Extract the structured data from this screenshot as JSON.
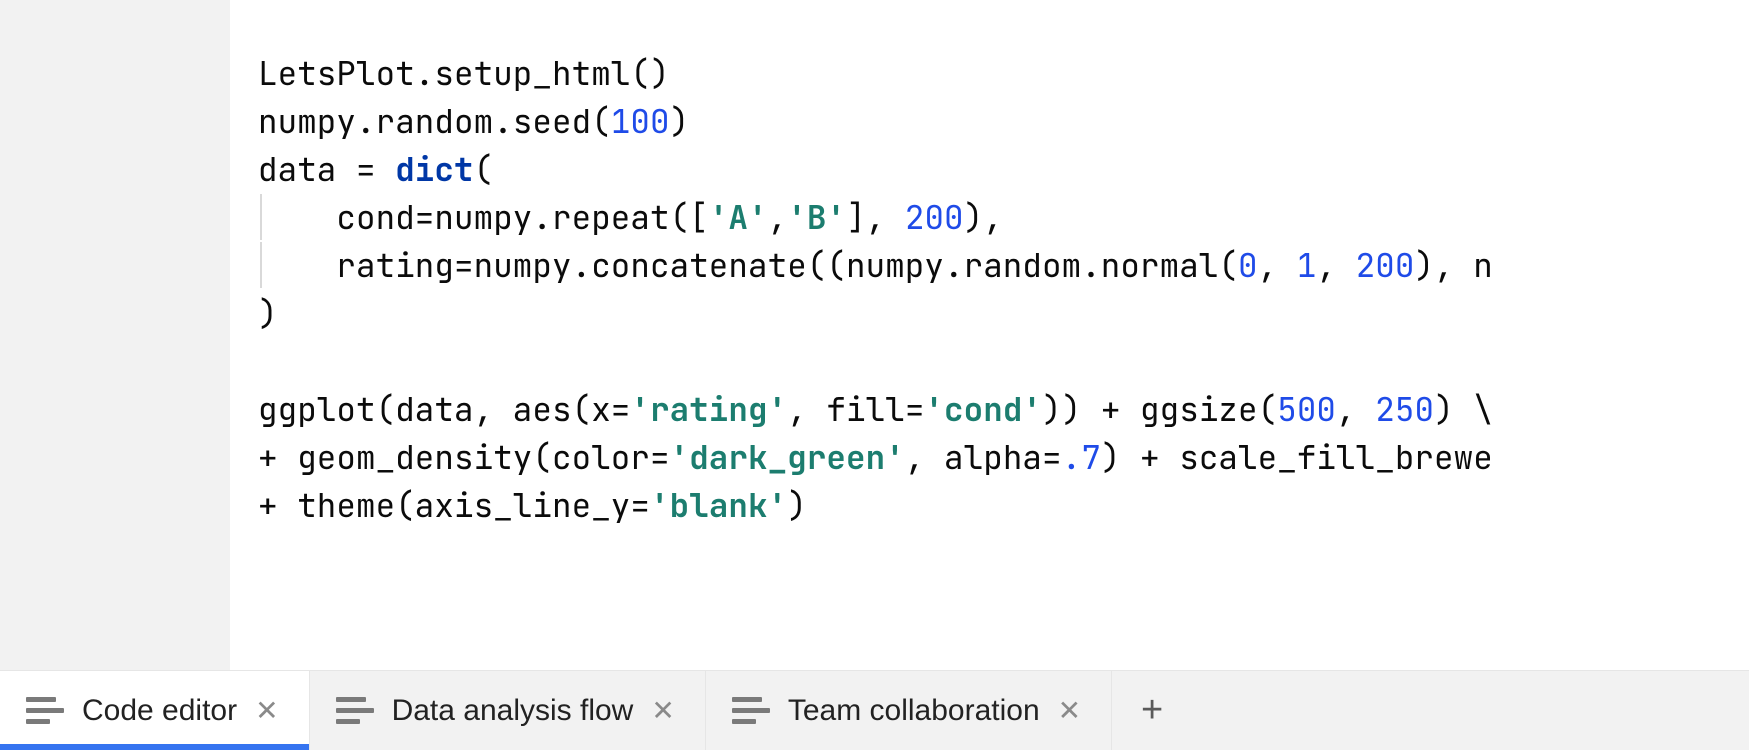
{
  "code": {
    "l1_a": "LetsPlot.setup_html()",
    "l2_a": "numpy.random.seed(",
    "l2_num": "100",
    "l2_b": ")",
    "l3_a": "data = ",
    "l3_kw": "dict",
    "l3_b": "(",
    "l4_a": "    cond=numpy.repeat([",
    "l4_s1": "'A'",
    "l4_m": ",",
    "l4_s2": "'B'",
    "l4_b": "], ",
    "l4_num": "200",
    "l4_c": "),",
    "l5_a": "    rating=numpy.concatenate((numpy.random.normal(",
    "l5_n1": "0",
    "l5_m1": ", ",
    "l5_n2": "1",
    "l5_m2": ", ",
    "l5_n3": "200",
    "l5_b": "), n",
    "l6_a": ")",
    "l8_a": "ggplot(data, aes(x=",
    "l8_s1": "'rating'",
    "l8_m1": ", fill=",
    "l8_s2": "'cond'",
    "l8_m2": ")) + ggsize(",
    "l8_n1": "500",
    "l8_m3": ", ",
    "l8_n2": "250",
    "l8_b": ") \\",
    "l9_a": "+ geom_density(color=",
    "l9_s1": "'dark_green'",
    "l9_m1": ", alpha=",
    "l9_n1": ".7",
    "l9_m2": ") + scale_fill_brewe",
    "l10_a": "+ theme(axis_line_y=",
    "l10_s1": "'blank'",
    "l10_b": ")"
  },
  "tabs": {
    "t1": "Code editor",
    "t2": "Data analysis flow",
    "t3": "Team collaboration"
  },
  "glyphs": {
    "close": "✕",
    "plus": "+"
  }
}
